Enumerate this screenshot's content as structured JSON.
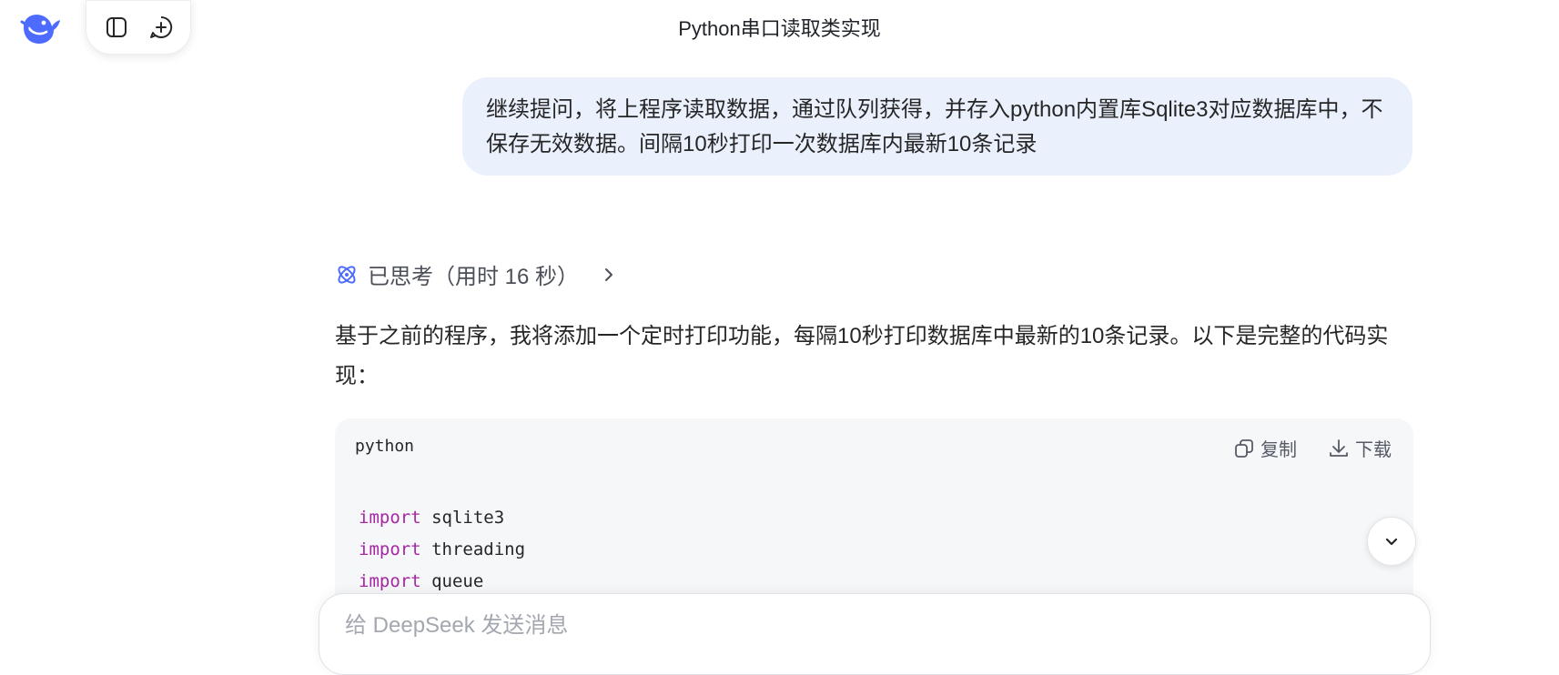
{
  "header": {
    "title": "Python串口读取类实现"
  },
  "user_message": {
    "text": "继续提问，将上程序读取数据，通过队列获得，并存入python内置库Sqlite3对应数据库中，不保存无效数据。间隔10秒打印一次数据库内最新10条记录"
  },
  "assistant": {
    "thinking_label": "已思考（用时 16 秒）",
    "reply_text": "基于之前的程序，我将添加一个定时打印功能，每隔10秒打印数据库中最新的10条记录。以下是完整的代码实现：",
    "code_block": {
      "language": "python",
      "copy_label": "复制",
      "download_label": "下载",
      "lines": [
        {
          "keyword": "import",
          "module": "sqlite3"
        },
        {
          "keyword": "import",
          "module": "threading"
        },
        {
          "keyword": "import",
          "module": "queue"
        }
      ]
    }
  },
  "composer": {
    "placeholder": "给 DeepSeek 发送消息"
  },
  "colors": {
    "brand": "#4d6bfe",
    "user_bubble": "#eaf1fd",
    "code_bg": "#f6f7f9",
    "keyword": "#a626a4"
  },
  "icons": [
    "deepseek-logo",
    "sidebar-toggle-icon",
    "new-chat-icon",
    "thinking-icon",
    "chevron-right-icon",
    "copy-icon",
    "download-icon",
    "chevron-down-icon"
  ]
}
